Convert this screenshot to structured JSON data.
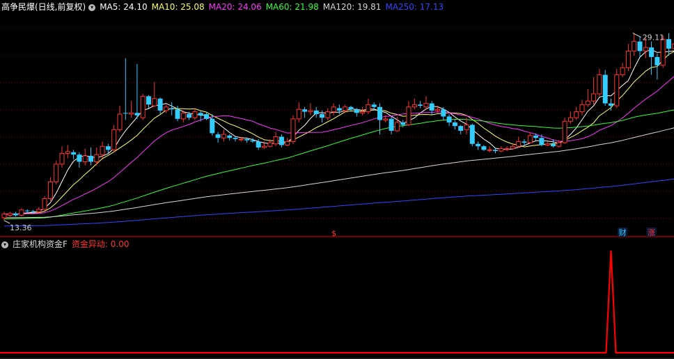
{
  "header": {
    "stock_title": "高争民爆(日线,前复权)",
    "ma": [
      {
        "label": "MA5: 24.10",
        "color": "#ffffff"
      },
      {
        "label": "MA10: 25.08",
        "color": "#ffff66"
      },
      {
        "label": "MA20: 24.06",
        "color": "#ff33ff"
      },
      {
        "label": "MA60: 21.98",
        "color": "#33ff33"
      },
      {
        "label": "MA120: 19.81",
        "color": "#d8d8d8"
      },
      {
        "label": "MA250: 17.13",
        "color": "#3344ff"
      }
    ]
  },
  "indicator_header": {
    "name": "庄家机构资金F",
    "value_label": "资金异动: 0.00"
  },
  "annotations": {
    "high_label": "29.11",
    "low_label": "13.36",
    "markers": [
      {
        "text": "$",
        "color": "#ff3333",
        "bar": 57
      },
      {
        "text": "财",
        "color": "#33ccff",
        "bar": 107
      },
      {
        "text": "涨",
        "color": "#ff3333",
        "bar": 112
      }
    ]
  },
  "colors": {
    "up": "#ff3333",
    "down": "#33ccff",
    "background": "#000000",
    "grid": "#7a0000",
    "indicator": "#ff0000"
  },
  "chart_data": {
    "type": "candlestick",
    "ylim": [
      12.6,
      30.6
    ],
    "high": 29.11,
    "low": 13.36,
    "indicator": {
      "name": "资金异动",
      "spike_index": 105,
      "spike_value": 1.0
    },
    "candles": [
      [
        13.6,
        13.9,
        13.36,
        14.1
      ],
      [
        13.8,
        13.95,
        13.6,
        14.1
      ],
      [
        13.95,
        13.8,
        13.7,
        14.1
      ],
      [
        13.8,
        14.25,
        13.7,
        14.4
      ],
      [
        14.2,
        14.15,
        14.0,
        14.3
      ],
      [
        14.15,
        14.1,
        13.95,
        14.25
      ],
      [
        14.1,
        14.3,
        14.0,
        14.5
      ],
      [
        14.3,
        15.2,
        14.2,
        15.4
      ],
      [
        15.2,
        16.6,
        15.0,
        17.0
      ],
      [
        16.6,
        18.1,
        16.4,
        18.4
      ],
      [
        18.1,
        19.0,
        17.8,
        19.6
      ],
      [
        19.0,
        19.15,
        18.6,
        19.7
      ],
      [
        19.1,
        18.9,
        18.5,
        19.3
      ],
      [
        18.9,
        18.3,
        17.8,
        19.1
      ],
      [
        18.3,
        18.8,
        18.0,
        19.4
      ],
      [
        18.8,
        18.3,
        18.0,
        19.5
      ],
      [
        18.3,
        18.9,
        18.0,
        19.5
      ],
      [
        18.9,
        19.6,
        18.6,
        20.0
      ],
      [
        19.6,
        19.3,
        19.0,
        19.8
      ],
      [
        19.3,
        21.0,
        19.1,
        21.4
      ],
      [
        21.0,
        22.3,
        20.8,
        23.0
      ],
      [
        22.4,
        22.35,
        21.8,
        27.0
      ],
      [
        22.3,
        22.4,
        22.0,
        23.4
      ],
      [
        22.4,
        22.2,
        21.9,
        26.5
      ],
      [
        22.0,
        23.8,
        21.8,
        24.0
      ],
      [
        23.8,
        23.1,
        22.8,
        23.9
      ],
      [
        23.0,
        23.6,
        22.9,
        25.0
      ],
      [
        23.6,
        22.6,
        22.3,
        23.7
      ],
      [
        22.6,
        22.9,
        22.4,
        23.1
      ],
      [
        22.8,
        22.7,
        22.2,
        23.3
      ],
      [
        22.7,
        21.9,
        21.7,
        23.0
      ],
      [
        21.9,
        22.4,
        21.6,
        22.6
      ],
      [
        22.3,
        22.0,
        21.8,
        22.5
      ],
      [
        22.0,
        22.5,
        21.8,
        22.8
      ],
      [
        22.4,
        22.2,
        21.7,
        22.6
      ],
      [
        22.3,
        21.9,
        21.8,
        22.5
      ],
      [
        21.9,
        20.7,
        20.5,
        22.3
      ],
      [
        20.6,
        20.3,
        19.9,
        20.8
      ],
      [
        20.3,
        20.6,
        20.0,
        21.0
      ],
      [
        20.5,
        20.3,
        20.1,
        20.6
      ],
      [
        20.3,
        20.2,
        20.0,
        20.5
      ],
      [
        20.2,
        20.2,
        20.0,
        20.4
      ],
      [
        20.2,
        20.1,
        19.9,
        20.35
      ],
      [
        20.1,
        20.0,
        19.9,
        20.3
      ],
      [
        20.0,
        19.5,
        19.3,
        20.2
      ],
      [
        19.5,
        19.6,
        19.4,
        20.0
      ],
      [
        19.6,
        19.9,
        19.5,
        20.2
      ],
      [
        19.8,
        20.4,
        19.6,
        20.8
      ],
      [
        20.4,
        19.7,
        19.5,
        20.6
      ],
      [
        19.7,
        20.0,
        19.6,
        20.3
      ],
      [
        20.0,
        21.9,
        19.8,
        22.2
      ],
      [
        21.9,
        22.7,
        21.6,
        23.3
      ],
      [
        22.7,
        22.5,
        22.0,
        22.9
      ],
      [
        22.5,
        22.6,
        22.2,
        23.2
      ],
      [
        22.6,
        22.3,
        22.0,
        22.9
      ],
      [
        22.3,
        22.0,
        21.6,
        22.6
      ],
      [
        22.0,
        22.5,
        21.8,
        22.8
      ],
      [
        22.5,
        22.9,
        22.2,
        23.2
      ],
      [
        22.8,
        22.6,
        22.3,
        23.1
      ],
      [
        22.6,
        22.9,
        22.4,
        23.1
      ],
      [
        22.9,
        22.7,
        22.5,
        23.0
      ],
      [
        22.7,
        22.4,
        22.1,
        22.8
      ],
      [
        22.4,
        22.5,
        22.2,
        22.9
      ],
      [
        22.5,
        23.1,
        22.3,
        23.6
      ],
      [
        23.1,
        22.9,
        22.6,
        23.3
      ],
      [
        22.9,
        21.8,
        20.6,
        23.2
      ],
      [
        21.8,
        21.9,
        21.6,
        22.2
      ],
      [
        21.9,
        20.9,
        20.6,
        22.1
      ],
      [
        20.9,
        21.6,
        20.8,
        22.1
      ],
      [
        21.6,
        21.4,
        21.2,
        21.8
      ],
      [
        21.4,
        22.9,
        21.3,
        23.4
      ],
      [
        22.9,
        23.1,
        22.7,
        23.6
      ],
      [
        23.1,
        23.0,
        22.8,
        23.4
      ],
      [
        22.9,
        23.2,
        22.7,
        23.8
      ],
      [
        23.2,
        22.6,
        22.2,
        23.4
      ],
      [
        22.6,
        22.7,
        22.4,
        23.0
      ],
      [
        22.7,
        22.1,
        21.8,
        22.9
      ],
      [
        22.1,
        21.6,
        21.3,
        22.3
      ],
      [
        21.6,
        21.3,
        21.0,
        21.8
      ],
      [
        21.3,
        20.9,
        20.6,
        21.4
      ],
      [
        21.0,
        21.4,
        20.6,
        22.0
      ],
      [
        21.4,
        19.8,
        19.6,
        21.5
      ],
      [
        19.8,
        19.6,
        19.3,
        20.0
      ],
      [
        19.6,
        19.3,
        19.2,
        19.7
      ],
      [
        19.3,
        19.3,
        19.1,
        19.6
      ],
      [
        19.3,
        19.2,
        19.0,
        19.5
      ],
      [
        19.2,
        19.4,
        19.1,
        19.6
      ],
      [
        19.4,
        19.4,
        19.2,
        19.6
      ],
      [
        19.4,
        19.6,
        19.3,
        19.8
      ],
      [
        19.6,
        20.0,
        19.5,
        20.4
      ],
      [
        20.0,
        19.9,
        19.7,
        20.2
      ],
      [
        19.9,
        20.5,
        19.8,
        20.8
      ],
      [
        20.5,
        20.3,
        20.1,
        20.7
      ],
      [
        20.3,
        19.7,
        19.6,
        20.6
      ],
      [
        19.7,
        19.8,
        19.6,
        20.0
      ],
      [
        19.8,
        19.6,
        19.5,
        20.2
      ],
      [
        19.6,
        19.9,
        19.5,
        20.1
      ],
      [
        19.9,
        21.7,
        19.8,
        22.0
      ],
      [
        21.7,
        22.0,
        21.5,
        22.5
      ],
      [
        22.0,
        22.5,
        21.8,
        22.9
      ],
      [
        22.5,
        23.1,
        22.2,
        23.5
      ],
      [
        23.1,
        23.4,
        22.9,
        24.4
      ],
      [
        23.4,
        24.0,
        23.1,
        25.4
      ],
      [
        24.0,
        25.6,
        23.8,
        26.1
      ],
      [
        25.6,
        23.2,
        23.0,
        26.0
      ],
      [
        23.2,
        23.0,
        22.6,
        23.6
      ],
      [
        23.0,
        25.6,
        22.8,
        26.1
      ],
      [
        25.6,
        26.2,
        25.4,
        26.6
      ],
      [
        26.2,
        27.6,
        25.9,
        28.2
      ],
      [
        27.6,
        28.4,
        27.2,
        29.11
      ],
      [
        28.4,
        27.6,
        27.1,
        28.8
      ],
      [
        27.6,
        27.9,
        27.0,
        28.7
      ],
      [
        27.9,
        27.1,
        25.6,
        28.4
      ],
      [
        27.1,
        26.4,
        25.2,
        27.4
      ],
      [
        26.4,
        28.6,
        26.2,
        28.9
      ],
      [
        28.6,
        27.8,
        27.2,
        29.1
      ],
      [
        27.8,
        28.2,
        27.5,
        28.9
      ],
      [
        28.2,
        27.6,
        26.6,
        28.5
      ]
    ]
  }
}
